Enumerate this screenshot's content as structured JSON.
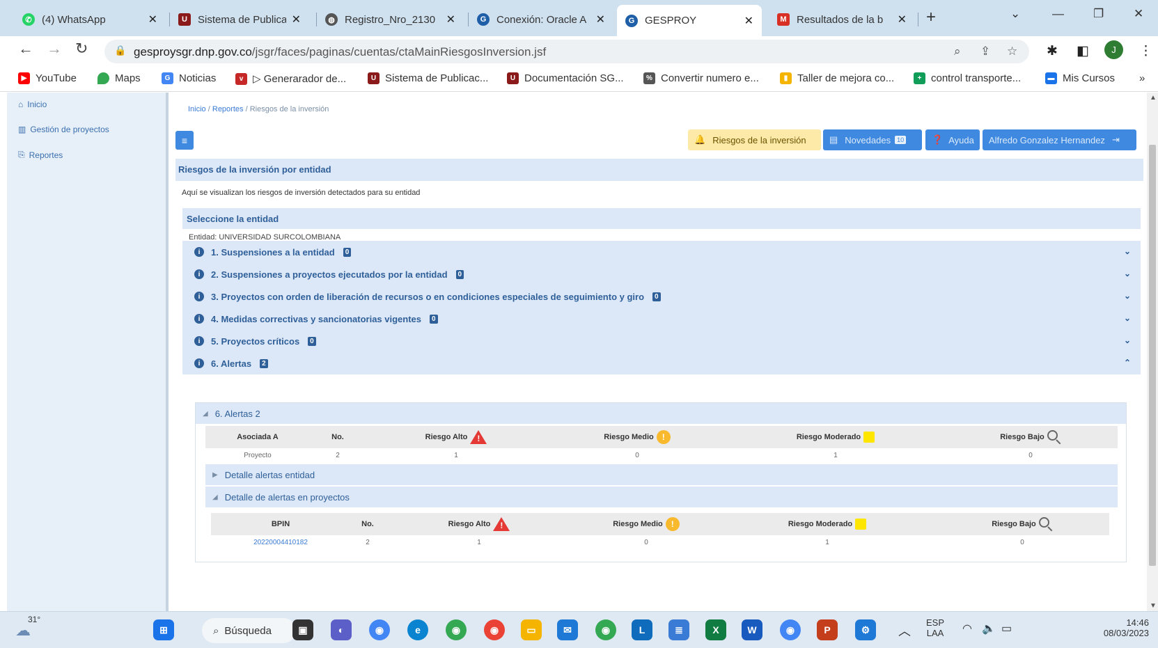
{
  "browser": {
    "tabs": [
      {
        "title": "(4) WhatsApp",
        "icon": "whatsapp-icon",
        "color": "#25d366"
      },
      {
        "title": "Sistema de Publica",
        "icon": "doc-icon",
        "color": "#8b1a1a"
      },
      {
        "title": "Registro_Nro_2130",
        "icon": "globe-icon",
        "color": "#555555"
      },
      {
        "title": "Conexión: Oracle A",
        "icon": "g-icon",
        "color": "#1f5fa8"
      },
      {
        "title": "GESPROY",
        "icon": "g-icon",
        "color": "#1f5fa8"
      },
      {
        "title": "Resultados de la b",
        "icon": "gmail-icon",
        "color": "#d93025"
      }
    ],
    "url_host": "gesproysgr.dnp.gov.co",
    "url_path": "/jsgr/faces/paginas/cuentas/ctaMainRiesgosInversion.jsf",
    "profile_initial": "J",
    "bookmarks": [
      {
        "label": "YouTube",
        "color": "#ff0000"
      },
      {
        "label": "Maps",
        "color": "#34a853"
      },
      {
        "label": "Noticias",
        "color": "#4285f4"
      },
      {
        "label": "▷ Generarador de...",
        "color": "#c62828"
      },
      {
        "label": "Sistema de Publicac...",
        "color": "#8b1a1a"
      },
      {
        "label": "Documentación SG...",
        "color": "#8b1a1a"
      },
      {
        "label": "Convertir numero e...",
        "color": "#555555"
      },
      {
        "label": "Taller de mejora co...",
        "color": "#f4b400"
      },
      {
        "label": "control transporte...",
        "color": "#0f9d58"
      },
      {
        "label": "Mis Cursos",
        "color": "#1a73e8"
      }
    ]
  },
  "sidebar": {
    "items": [
      {
        "label": "Inicio",
        "icon": "home-icon"
      },
      {
        "label": "Gestión de proyectos",
        "icon": "chart-icon"
      },
      {
        "label": "Reportes",
        "icon": "report-icon"
      }
    ]
  },
  "breadcrumb": {
    "home": "Inicio",
    "sep": "/",
    "section": "Reportes",
    "page": "/ Riesgos de la inversión"
  },
  "topbar": {
    "riesgos": "Riesgos de la inversión",
    "novedades": "Novedades",
    "novedades_count": "10",
    "ayuda": "Ayuda",
    "user": "Alfredo Gonzalez Hernandez"
  },
  "main": {
    "title": "Riesgos de la inversión por entidad",
    "description": "Aquí se visualizan los riesgos de inversión detectados para su entidad",
    "select_title": "Seleccione la entidad",
    "entidad": "Entidad: UNIVERSIDAD SURCOLOMBIANA",
    "accordions": [
      {
        "label": "1. Suspensiones a la entidad",
        "count": "0",
        "state": "collapsed"
      },
      {
        "label": "2. Suspensiones a proyectos ejecutados por la entidad",
        "count": "0",
        "state": "collapsed"
      },
      {
        "label": "3. Proyectos con orden de liberación de recursos o en condiciones especiales de seguimiento y giro",
        "count": "0",
        "state": "collapsed"
      },
      {
        "label": "4. Medidas correctivas y sancionatorias vigentes",
        "count": "0",
        "state": "collapsed"
      },
      {
        "label": "5. Proyectos críticos",
        "count": "0",
        "state": "collapsed"
      },
      {
        "label": "6. Alertas",
        "count": "2",
        "state": "expanded"
      }
    ]
  },
  "alertas": {
    "panel_title": "6. Alertas 2",
    "summary": {
      "headers": [
        "Asociada A",
        "No.",
        "Riesgo Alto",
        "Riesgo Medio",
        "Riesgo Moderado",
        "Riesgo Bajo"
      ],
      "row": [
        "Proyecto",
        "2",
        "1",
        "0",
        "1",
        "0"
      ]
    },
    "detalle_entidad": "Detalle alertas entidad",
    "detalle_proyectos": "Detalle de alertas en proyectos",
    "projects": {
      "headers": [
        "BPIN",
        "No.",
        "Riesgo Alto",
        "Riesgo Medio",
        "Riesgo Moderado",
        "Riesgo Bajo"
      ],
      "row": [
        "20220004410182",
        "2",
        "1",
        "0",
        "1",
        "0"
      ]
    }
  },
  "taskbar": {
    "temperature": "31°",
    "search": "Búsqueda",
    "lang": "ESP",
    "layout": "LAA",
    "time": "14:46",
    "date": "08/03/2023"
  }
}
